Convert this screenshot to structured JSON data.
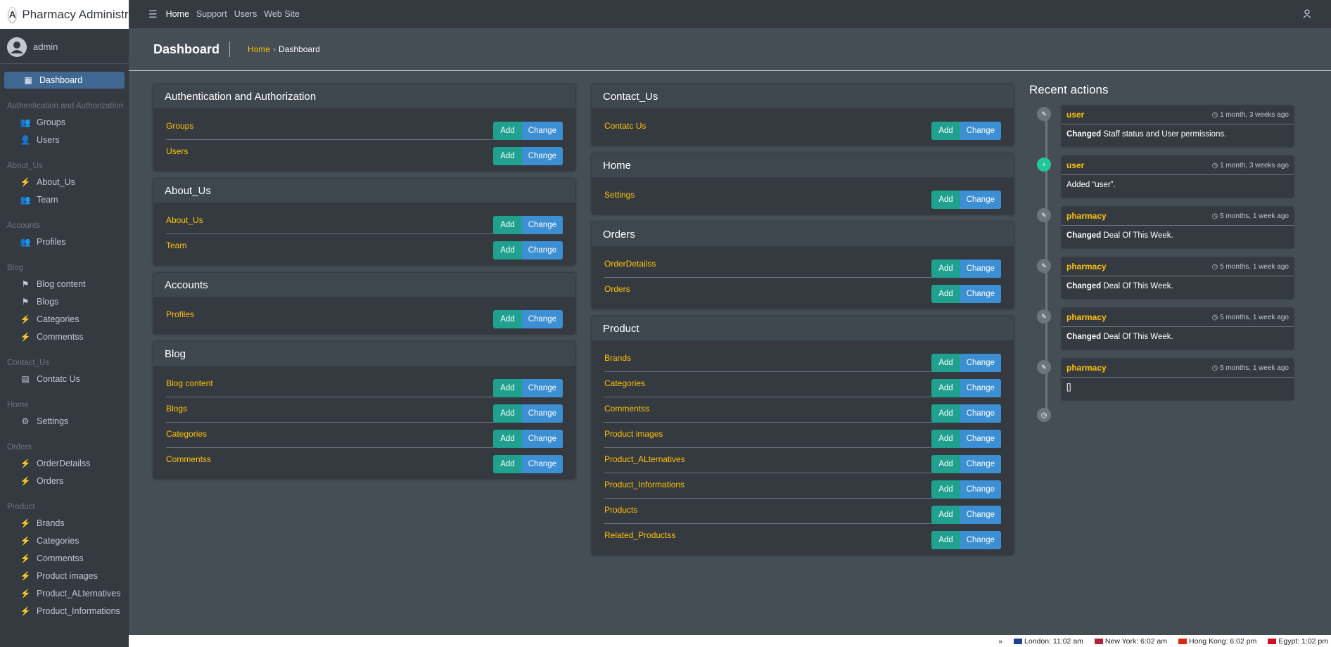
{
  "brand": {
    "name": "Pharmacy Administra",
    "logo_icon": "app-logo-icon"
  },
  "user": {
    "name": "admin"
  },
  "topbar": {
    "links": [
      "Home",
      "Support",
      "Users",
      "Web Site"
    ]
  },
  "sidebar": {
    "dashboard": "Dashboard",
    "sections": [
      {
        "header": "Authentication and Authorization",
        "items": [
          "Groups",
          "Users"
        ]
      },
      {
        "header": "About_Us",
        "items": [
          "About_Us",
          "Team"
        ]
      },
      {
        "header": "Accounts",
        "items": [
          "Profiles"
        ]
      },
      {
        "header": "Blog",
        "items": [
          "Blog content",
          "Blogs",
          "Categories",
          "Commentss"
        ]
      },
      {
        "header": "Contact_Us",
        "items": [
          "Contatc Us"
        ]
      },
      {
        "header": "Home",
        "items": [
          "Settings"
        ]
      },
      {
        "header": "Orders",
        "items": [
          "OrderDetailss",
          "Orders"
        ]
      },
      {
        "header": "Product",
        "items": [
          "Brands",
          "Categories",
          "Commentss",
          "Product images",
          "Product_ALternatives",
          "Product_Informations"
        ]
      }
    ]
  },
  "header": {
    "title": "Dashboard",
    "breadcrumb_home": "Home",
    "breadcrumb_current": "Dashboard"
  },
  "buttons": {
    "add": "Add",
    "change": "Change"
  },
  "left_column": [
    {
      "title": "Authentication and Authorization",
      "models": [
        "Groups",
        "Users"
      ]
    },
    {
      "title": "About_Us",
      "models": [
        "About_Us",
        "Team"
      ]
    },
    {
      "title": "Accounts",
      "models": [
        "Profiles"
      ]
    },
    {
      "title": "Blog",
      "models": [
        "Blog content",
        "Blogs",
        "Categories",
        "Commentss"
      ]
    }
  ],
  "right_column": [
    {
      "title": "Contact_Us",
      "models": [
        "Contatc Us"
      ]
    },
    {
      "title": "Home",
      "models": [
        "Settings"
      ]
    },
    {
      "title": "Orders",
      "models": [
        "OrderDetailss",
        "Orders"
      ]
    },
    {
      "title": "Product",
      "models": [
        "Brands",
        "Categories",
        "Commentss",
        "Product images",
        "Product_ALternatives",
        "Product_Informations",
        "Products",
        "Related_Productss"
      ]
    }
  ],
  "recent": {
    "title": "Recent actions",
    "items": [
      {
        "user": "user",
        "time": "1 month, 3 weeks ago",
        "verb": "Changed",
        "text": "Staff status and User permissions.",
        "kind": "edit"
      },
      {
        "user": "user",
        "time": "1 month, 3 weeks ago",
        "verb": "",
        "text": "Added “user”.",
        "kind": "add"
      },
      {
        "user": "pharmacy",
        "time": "5 months, 1 week ago",
        "verb": "Changed",
        "text": "Deal Of This Week.",
        "kind": "edit"
      },
      {
        "user": "pharmacy",
        "time": "5 months, 1 week ago",
        "verb": "Changed",
        "text": "Deal Of This Week.",
        "kind": "edit"
      },
      {
        "user": "pharmacy",
        "time": "5 months, 1 week ago",
        "verb": "Changed",
        "text": "Deal Of This Week.",
        "kind": "edit"
      },
      {
        "user": "pharmacy",
        "time": "5 months, 1 week ago",
        "verb": "",
        "text": "[]",
        "kind": "edit"
      }
    ]
  },
  "clocks": [
    {
      "label": "London: 11:02 am",
      "flag_color": "#1f3f8f"
    },
    {
      "label": "New York: 6:02 am",
      "flag_color": "#b22234"
    },
    {
      "label": "Hong Kong: 6:02 pm",
      "flag_color": "#de2910"
    },
    {
      "label": "Egypt: 1:02 pm",
      "flag_color": "#ce1126"
    }
  ],
  "clock_prefix": "»"
}
